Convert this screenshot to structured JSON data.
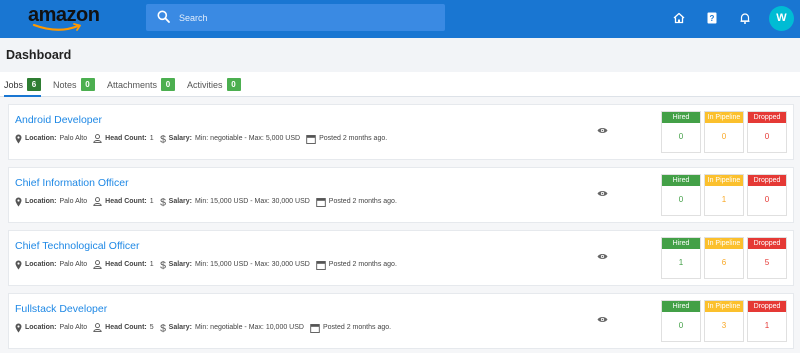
{
  "brand": {
    "logo_text": "amazon"
  },
  "search": {
    "placeholder": "Search"
  },
  "user": {
    "initial": "W"
  },
  "colors": {
    "topbar": "#1976d2",
    "avatar": "#00bcd4",
    "hired": "#43a047",
    "pipeline": "#fbc02d",
    "dropped": "#e53935",
    "link": "#1e88e5"
  },
  "page": {
    "title": "Dashboard"
  },
  "tabs": [
    {
      "label": "Jobs",
      "count": "6"
    },
    {
      "label": "Notes",
      "count": "0"
    },
    {
      "label": "Attachments",
      "count": "0"
    },
    {
      "label": "Activities",
      "count": "0"
    }
  ],
  "labels": {
    "location": "Location:",
    "head_count": "Head Count:",
    "salary": "Salary:",
    "hired": "Hired",
    "pipeline": "In Pipeline",
    "dropped": "Dropped"
  },
  "jobs": [
    {
      "title": "Android Developer",
      "location": "Palo Alto",
      "head_count": "1",
      "salary": "Min: negotiable - Max: 5,000 USD",
      "posted": "Posted 2 months ago.",
      "hired": "0",
      "pipeline": "0",
      "dropped": "0"
    },
    {
      "title": "Chief Information Officer",
      "location": "Palo Alto",
      "head_count": "1",
      "salary": "Min: 15,000 USD - Max: 30,000 USD",
      "posted": "Posted 2 months ago.",
      "hired": "0",
      "pipeline": "1",
      "dropped": "0"
    },
    {
      "title": "Chief Technological Officer",
      "location": "Palo Alto",
      "head_count": "1",
      "salary": "Min: 15,000 USD - Max: 30,000 USD",
      "posted": "Posted 2 months ago.",
      "hired": "1",
      "pipeline": "6",
      "dropped": "5"
    },
    {
      "title": "Fullstack Developer",
      "location": "Palo Alto",
      "head_count": "5",
      "salary": "Min: negotiable - Max: 10,000 USD",
      "posted": "Posted 2 months ago.",
      "hired": "0",
      "pipeline": "3",
      "dropped": "1"
    }
  ]
}
